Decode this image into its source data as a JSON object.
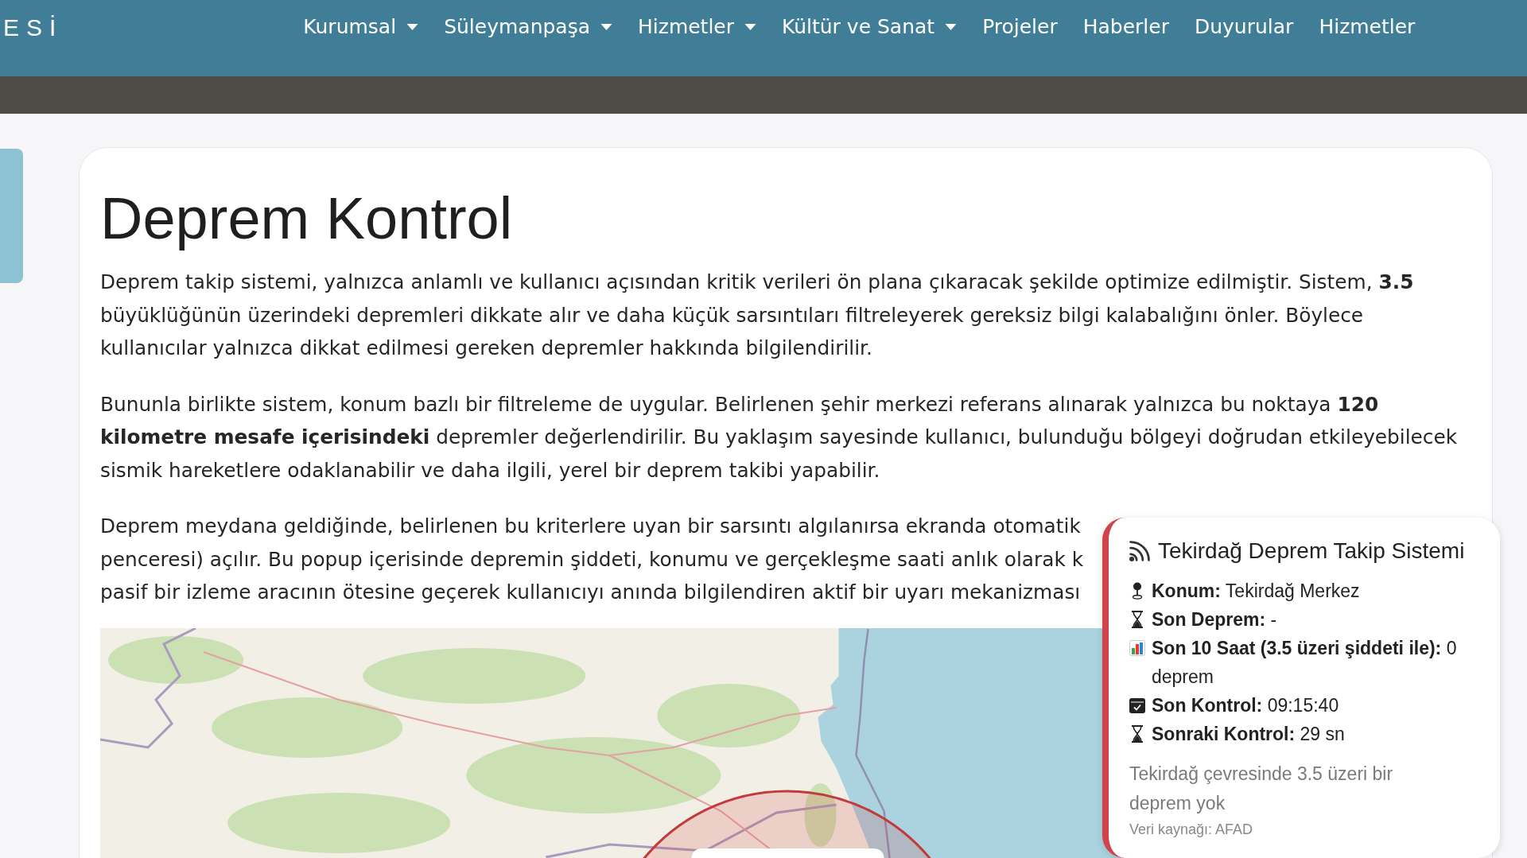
{
  "header": {
    "logo_text": "ESİ",
    "nav": [
      {
        "label": "Kurumsal",
        "dropdown": true
      },
      {
        "label": "Süleymanpaşa",
        "dropdown": true
      },
      {
        "label": "Hizmetler",
        "dropdown": true
      },
      {
        "label": "Kültür ve Sanat",
        "dropdown": true
      },
      {
        "label": "Projeler",
        "dropdown": false
      },
      {
        "label": "Haberler",
        "dropdown": false
      },
      {
        "label": "Duyurular",
        "dropdown": false
      },
      {
        "label": "Hizmetler",
        "dropdown": false
      }
    ]
  },
  "content": {
    "title": "Deprem Kontrol",
    "paragraphs": [
      "Deprem takip sistemi, yalnızca anlamlı ve kullanıcı açısından kritik verileri ön plana çıkaracak şekilde optimize edilmiştir. Sistem, **3.5** büyüklüğünün üzerindeki depremleri dikkate alır ve daha küçük sarsıntıları filtreleyerek gereksiz bilgi kalabalığını önler. Böylece kullanıcılar yalnızca dikkat edilmesi gereken depremler hakkında bilgilendirilir.",
      "Bununla birlikte sistem, konum bazlı bir filtreleme de uygular. Belirlenen şehir merkezi referans alınarak yalnızca bu noktaya **120 kilometre mesafe içerisindeki** depremler değerlendirilir. Bu yaklaşım sayesinde kullanıcı, bulunduğu bölgeyi doğrudan etkileyebilecek sismik hareketlere odaklanabilir ve daha ilgili, yerel bir deprem takibi yapabilir."
    ],
    "covered_paragraph_lines": [
      "Deprem meydana geldiğinde, belirlenen bu kriterlere uyan bir sarsıntı algılanırsa ekranda otomatik",
      "penceresi) açılır. Bu popup içerisinde depremin şiddeti, konumu ve gerçekleşme saati anlık olarak k",
      "pasif bir izleme aracının ötesine geçerek kullanıcıyı anında bilgilendiren aktif bir uyarı mekanizması"
    ]
  },
  "alert_popup": {
    "title": "Tekirdağ Deprem Takip Sistemi",
    "rows": [
      {
        "kind": "location",
        "text": "**Konum:** Tekirdağ Merkez"
      },
      {
        "kind": "hourglass",
        "text": "**Son Deprem:** -"
      },
      {
        "kind": "chart",
        "text": "**Son 10 Saat (3.5 üzeri şiddeti ile):** 0 deprem"
      },
      {
        "kind": "calendar",
        "text": "**Son Kontrol:** 09:15:40"
      },
      {
        "kind": "hourglass",
        "text": "**Sonraki Kontrol:** 29 sn"
      }
    ],
    "message": "Tekirdağ çevresinde 3.5 üzeri bir deprem yok",
    "source": "Veri kaynağı: AFAD"
  }
}
